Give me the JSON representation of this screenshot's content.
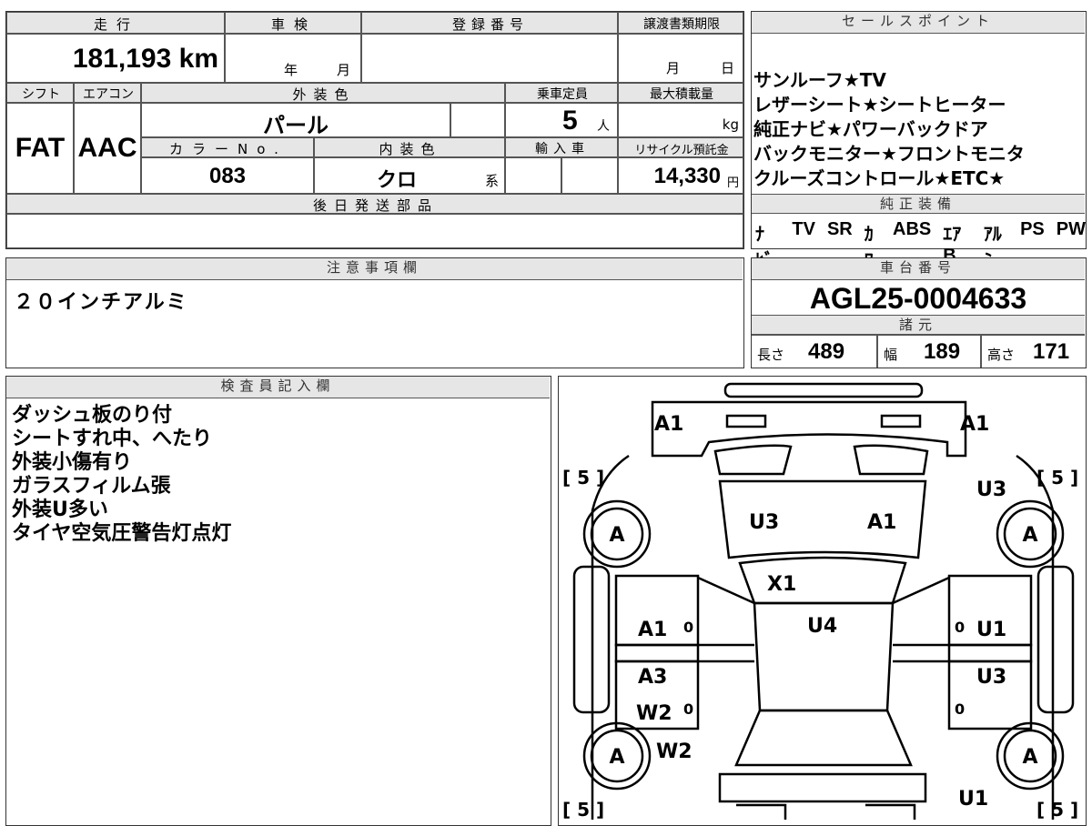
{
  "summary": {
    "mileage_label": "走行",
    "mileage_value": "181,193 km",
    "inspection_label": "車検",
    "inspection_year": "年",
    "inspection_month": "月",
    "registration_label": "登録番号",
    "transfer_label": "譲渡書類期限",
    "transfer_month": "月",
    "transfer_day": "日",
    "shift_label": "シフト",
    "shift_value": "FAT",
    "ac_label": "エアコン",
    "ac_value": "AAC",
    "exterior_color_label": "外装色",
    "exterior_color_value": "パール",
    "capacity_label": "乗車定員",
    "capacity_value": "5",
    "capacity_unit": "人",
    "max_load_label": "最大積載量",
    "max_load_unit": "kg",
    "color_no_label": "カラーNo.",
    "color_no_value": "083",
    "interior_color_label": "内装色",
    "interior_color_value": "クロ",
    "interior_color_suffix": "系",
    "import_label": "輸入車",
    "recycle_label": "リサイクル預託金",
    "recycle_value": "14,330",
    "recycle_unit": "円",
    "later_parts_label": "後日発送部品"
  },
  "sales_points": {
    "title": "セールスポイント",
    "lines": [
      "サンルーフ★TV",
      "レザーシート★シートヒーター",
      "純正ナビ★パワーバックドア",
      "バックモニター★フロントモニタ",
      "クルーズコントロール★ETC★"
    ]
  },
  "equipment": {
    "title": "純正装備",
    "items": [
      "ﾅﾋﾞ",
      "TV",
      "SR",
      "ｶﾜ",
      "ABS",
      "ｴｱB",
      "ｱﾙﾐ",
      "PS",
      "PW"
    ]
  },
  "notes": {
    "title": "注意事項欄",
    "text": "２０インチアルミ"
  },
  "chassis": {
    "title": "車台番号",
    "value": "AGL25-0004633",
    "specs_title": "諸元",
    "length_label": "長さ",
    "length_value": "489",
    "width_label": "幅",
    "width_value": "189",
    "height_label": "高さ",
    "height_value": "171"
  },
  "inspector": {
    "title": "検査員記入欄",
    "lines": [
      "ダッシュ板のり付",
      "シートすれ中、へたり",
      "外装小傷有り",
      "ガラスフィルム張",
      "外装U多い",
      "タイヤ空気圧警告灯点灯"
    ]
  },
  "diagram": {
    "tire_grade": "A",
    "tire_tread": "[ 5 ]",
    "marks": {
      "front_left": "A1",
      "front_right": "A1",
      "right_fender": "U3",
      "windshield_left": "U3",
      "windshield_right": "A1",
      "hood": "X1",
      "roof": "U4",
      "left_front_door": "A1",
      "left_front_door_zero": "0",
      "left_rear_door_1": "A3",
      "left_rear_door_2": "W2",
      "left_rear_zero": "0",
      "left_rear_quarter": "W2",
      "right_front_door_zero": "0",
      "right_front_door": "U1",
      "right_rear_door": "U3",
      "right_rear_zero": "0",
      "right_rear_quarter": "U1"
    }
  }
}
